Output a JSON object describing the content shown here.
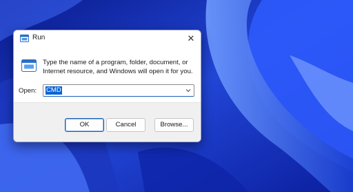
{
  "dialog": {
    "title": "Run",
    "close_glyph": "✕",
    "description": "Type the name of a program, folder, document, or Internet resource, and Windows will open it for you.",
    "open_label": "Open:",
    "open_value": "CMD",
    "buttons": {
      "ok": "OK",
      "cancel": "Cancel",
      "browse": "Browse..."
    },
    "icons": {
      "title": "run-icon",
      "large": "run-icon",
      "dropdown": "chevron-down-icon"
    }
  },
  "colors": {
    "accent": "#0a64d6",
    "wallpaper_base": "#1f3fc4"
  }
}
